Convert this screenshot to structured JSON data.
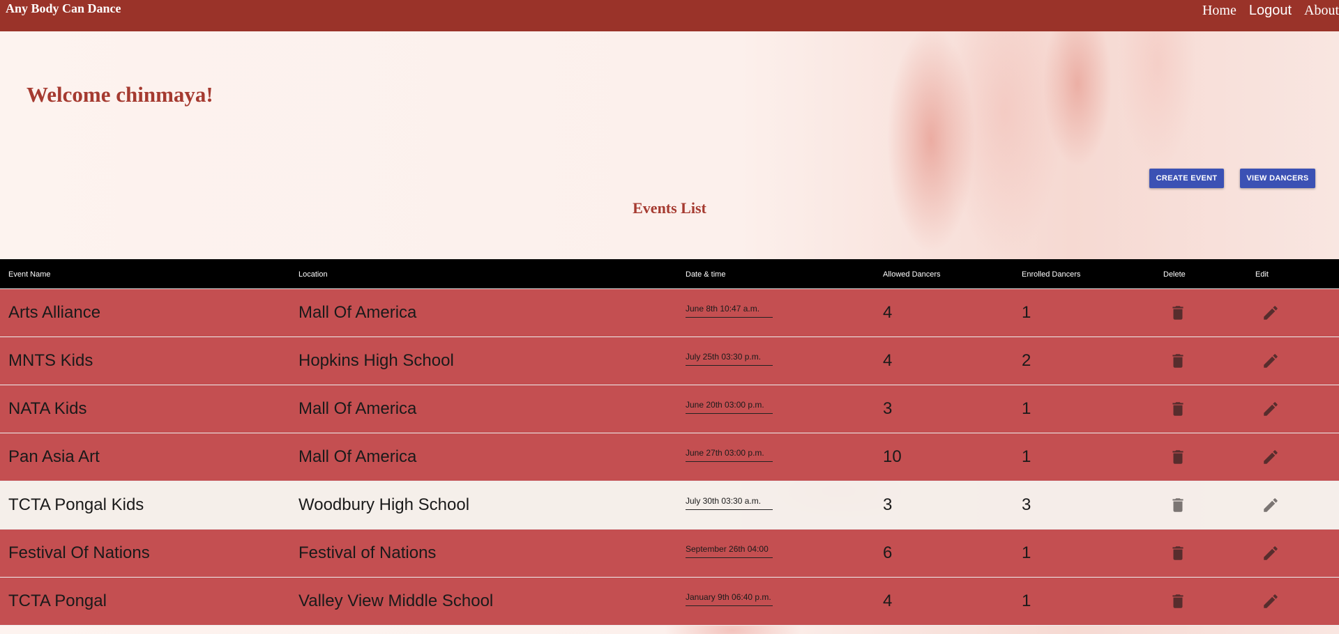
{
  "navbar": {
    "brand": "Any Body Can Dance",
    "links": [
      "Home",
      "Logout",
      "About"
    ]
  },
  "welcome": "Welcome chinmaya!",
  "buttons": {
    "create_event": "CREATE EVENT",
    "view_dancers": "VIEW DANCERS"
  },
  "events_title": "Events List",
  "table": {
    "headers": [
      "Event Name",
      "Location",
      "Date & time",
      "Allowed Dancers",
      "Enrolled Dancers",
      "Delete",
      "Edit"
    ],
    "rows": [
      {
        "name": "Arts Alliance",
        "location": "Mall Of America",
        "date": "June 8th 10:47 a.m.",
        "allowed": "4",
        "enrolled": "1"
      },
      {
        "name": "MNTS Kids",
        "location": "Hopkins High School",
        "date": "July 25th 03:30 p.m.",
        "allowed": "4",
        "enrolled": "2"
      },
      {
        "name": "NATA Kids",
        "location": "Mall Of America",
        "date": "June 20th 03:00 p.m.",
        "allowed": "3",
        "enrolled": "1"
      },
      {
        "name": "Pan Asia Art",
        "location": "Mall Of America",
        "date": "June 27th 03:00 p.m.",
        "allowed": "10",
        "enrolled": "1"
      },
      {
        "name": "TCTA Pongal Kids",
        "location": "Woodbury High School",
        "date": "July 30th 03:30 a.m.",
        "allowed": "3",
        "enrolled": "3"
      },
      {
        "name": "Festival Of Nations",
        "location": "Festival of Nations",
        "date": "September 26th 04:00",
        "allowed": "6",
        "enrolled": "1"
      },
      {
        "name": "TCTA Pongal",
        "location": "Valley View Middle School",
        "date": "January 9th 06:40 p.m.",
        "allowed": "4",
        "enrolled": "1"
      }
    ]
  },
  "icons": {
    "delete": "trash-icon",
    "edit": "pencil-icon"
  },
  "colors": {
    "navbar": "#9a3329",
    "accent_text": "#a53a30",
    "button": "#3b51b4",
    "row": "#c44f51",
    "row_highlight": "#f4eeea",
    "header": "#000000"
  }
}
